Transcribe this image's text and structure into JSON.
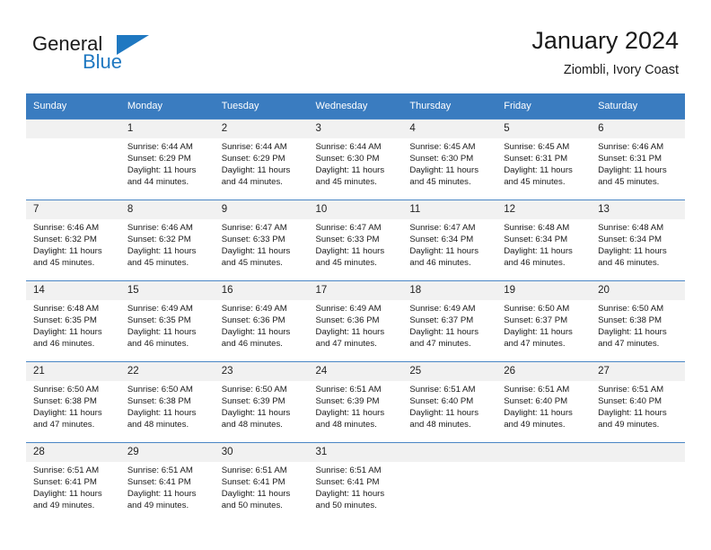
{
  "brand": {
    "name_part1": "General",
    "name_part2": "Blue",
    "flag_icon": "triangle-flag-icon",
    "accent_color": "#1f78c1"
  },
  "header": {
    "title": "January 2024",
    "subtitle": "Ziombli, Ivory Coast"
  },
  "calendar": {
    "header_bg": "#3a7cc0",
    "daynum_bg": "#f1f1f1",
    "weekday_headers": [
      "Sunday",
      "Monday",
      "Tuesday",
      "Wednesday",
      "Thursday",
      "Friday",
      "Saturday"
    ],
    "weeks": [
      [
        {
          "day": "",
          "lines": []
        },
        {
          "day": "1",
          "lines": [
            "Sunrise: 6:44 AM",
            "Sunset: 6:29 PM",
            "Daylight: 11 hours",
            "and 44 minutes."
          ]
        },
        {
          "day": "2",
          "lines": [
            "Sunrise: 6:44 AM",
            "Sunset: 6:29 PM",
            "Daylight: 11 hours",
            "and 44 minutes."
          ]
        },
        {
          "day": "3",
          "lines": [
            "Sunrise: 6:44 AM",
            "Sunset: 6:30 PM",
            "Daylight: 11 hours",
            "and 45 minutes."
          ]
        },
        {
          "day": "4",
          "lines": [
            "Sunrise: 6:45 AM",
            "Sunset: 6:30 PM",
            "Daylight: 11 hours",
            "and 45 minutes."
          ]
        },
        {
          "day": "5",
          "lines": [
            "Sunrise: 6:45 AM",
            "Sunset: 6:31 PM",
            "Daylight: 11 hours",
            "and 45 minutes."
          ]
        },
        {
          "day": "6",
          "lines": [
            "Sunrise: 6:46 AM",
            "Sunset: 6:31 PM",
            "Daylight: 11 hours",
            "and 45 minutes."
          ]
        }
      ],
      [
        {
          "day": "7",
          "lines": [
            "Sunrise: 6:46 AM",
            "Sunset: 6:32 PM",
            "Daylight: 11 hours",
            "and 45 minutes."
          ]
        },
        {
          "day": "8",
          "lines": [
            "Sunrise: 6:46 AM",
            "Sunset: 6:32 PM",
            "Daylight: 11 hours",
            "and 45 minutes."
          ]
        },
        {
          "day": "9",
          "lines": [
            "Sunrise: 6:47 AM",
            "Sunset: 6:33 PM",
            "Daylight: 11 hours",
            "and 45 minutes."
          ]
        },
        {
          "day": "10",
          "lines": [
            "Sunrise: 6:47 AM",
            "Sunset: 6:33 PM",
            "Daylight: 11 hours",
            "and 45 minutes."
          ]
        },
        {
          "day": "11",
          "lines": [
            "Sunrise: 6:47 AM",
            "Sunset: 6:34 PM",
            "Daylight: 11 hours",
            "and 46 minutes."
          ]
        },
        {
          "day": "12",
          "lines": [
            "Sunrise: 6:48 AM",
            "Sunset: 6:34 PM",
            "Daylight: 11 hours",
            "and 46 minutes."
          ]
        },
        {
          "day": "13",
          "lines": [
            "Sunrise: 6:48 AM",
            "Sunset: 6:34 PM",
            "Daylight: 11 hours",
            "and 46 minutes."
          ]
        }
      ],
      [
        {
          "day": "14",
          "lines": [
            "Sunrise: 6:48 AM",
            "Sunset: 6:35 PM",
            "Daylight: 11 hours",
            "and 46 minutes."
          ]
        },
        {
          "day": "15",
          "lines": [
            "Sunrise: 6:49 AM",
            "Sunset: 6:35 PM",
            "Daylight: 11 hours",
            "and 46 minutes."
          ]
        },
        {
          "day": "16",
          "lines": [
            "Sunrise: 6:49 AM",
            "Sunset: 6:36 PM",
            "Daylight: 11 hours",
            "and 46 minutes."
          ]
        },
        {
          "day": "17",
          "lines": [
            "Sunrise: 6:49 AM",
            "Sunset: 6:36 PM",
            "Daylight: 11 hours",
            "and 47 minutes."
          ]
        },
        {
          "day": "18",
          "lines": [
            "Sunrise: 6:49 AM",
            "Sunset: 6:37 PM",
            "Daylight: 11 hours",
            "and 47 minutes."
          ]
        },
        {
          "day": "19",
          "lines": [
            "Sunrise: 6:50 AM",
            "Sunset: 6:37 PM",
            "Daylight: 11 hours",
            "and 47 minutes."
          ]
        },
        {
          "day": "20",
          "lines": [
            "Sunrise: 6:50 AM",
            "Sunset: 6:38 PM",
            "Daylight: 11 hours",
            "and 47 minutes."
          ]
        }
      ],
      [
        {
          "day": "21",
          "lines": [
            "Sunrise: 6:50 AM",
            "Sunset: 6:38 PM",
            "Daylight: 11 hours",
            "and 47 minutes."
          ]
        },
        {
          "day": "22",
          "lines": [
            "Sunrise: 6:50 AM",
            "Sunset: 6:38 PM",
            "Daylight: 11 hours",
            "and 48 minutes."
          ]
        },
        {
          "day": "23",
          "lines": [
            "Sunrise: 6:50 AM",
            "Sunset: 6:39 PM",
            "Daylight: 11 hours",
            "and 48 minutes."
          ]
        },
        {
          "day": "24",
          "lines": [
            "Sunrise: 6:51 AM",
            "Sunset: 6:39 PM",
            "Daylight: 11 hours",
            "and 48 minutes."
          ]
        },
        {
          "day": "25",
          "lines": [
            "Sunrise: 6:51 AM",
            "Sunset: 6:40 PM",
            "Daylight: 11 hours",
            "and 48 minutes."
          ]
        },
        {
          "day": "26",
          "lines": [
            "Sunrise: 6:51 AM",
            "Sunset: 6:40 PM",
            "Daylight: 11 hours",
            "and 49 minutes."
          ]
        },
        {
          "day": "27",
          "lines": [
            "Sunrise: 6:51 AM",
            "Sunset: 6:40 PM",
            "Daylight: 11 hours",
            "and 49 minutes."
          ]
        }
      ],
      [
        {
          "day": "28",
          "lines": [
            "Sunrise: 6:51 AM",
            "Sunset: 6:41 PM",
            "Daylight: 11 hours",
            "and 49 minutes."
          ]
        },
        {
          "day": "29",
          "lines": [
            "Sunrise: 6:51 AM",
            "Sunset: 6:41 PM",
            "Daylight: 11 hours",
            "and 49 minutes."
          ]
        },
        {
          "day": "30",
          "lines": [
            "Sunrise: 6:51 AM",
            "Sunset: 6:41 PM",
            "Daylight: 11 hours",
            "and 50 minutes."
          ]
        },
        {
          "day": "31",
          "lines": [
            "Sunrise: 6:51 AM",
            "Sunset: 6:41 PM",
            "Daylight: 11 hours",
            "and 50 minutes."
          ]
        },
        {
          "day": "",
          "lines": []
        },
        {
          "day": "",
          "lines": []
        },
        {
          "day": "",
          "lines": []
        }
      ]
    ]
  }
}
